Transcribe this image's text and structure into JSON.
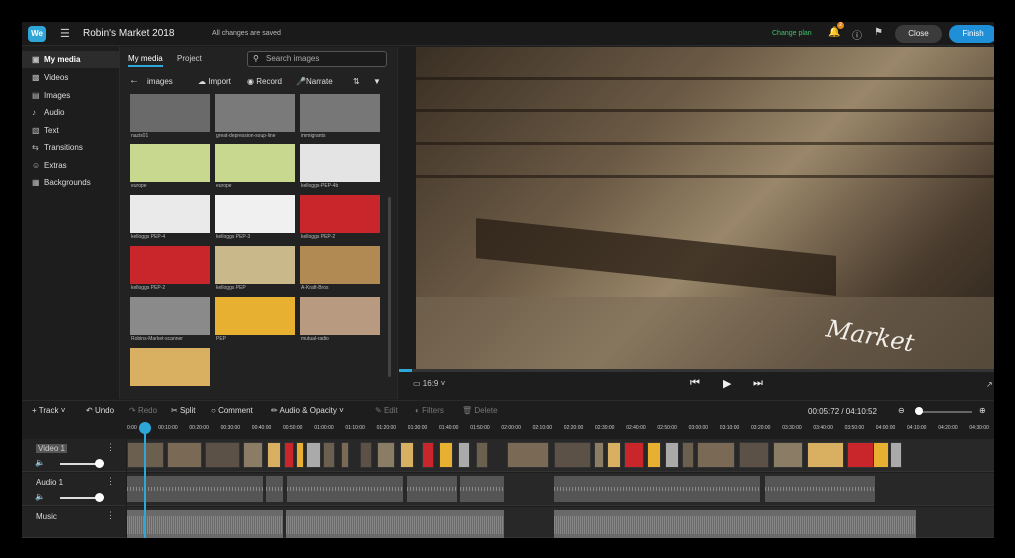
{
  "app": {
    "logo": "We",
    "title": "Robin's Market 2018",
    "save_status": "All changes are saved",
    "change_plan": "Change plan",
    "notification_count": "2",
    "close_label": "Close",
    "finish_label": "Finish",
    "accent": "#2ea7d8"
  },
  "nav": {
    "items": [
      {
        "label": "My media",
        "icon": "folder-icon"
      },
      {
        "label": "Videos",
        "icon": "film-icon"
      },
      {
        "label": "Images",
        "icon": "image-icon"
      },
      {
        "label": "Audio",
        "icon": "music-note-icon"
      },
      {
        "label": "Text",
        "icon": "text-icon"
      },
      {
        "label": "Transitions",
        "icon": "transition-icon"
      },
      {
        "label": "Extras",
        "icon": "smile-icon"
      },
      {
        "label": "Backgrounds",
        "icon": "background-icon"
      }
    ]
  },
  "media": {
    "tabs": [
      "My media",
      "Project"
    ],
    "search_placeholder": "Search images",
    "folder": "images",
    "import_label": "Import",
    "record_label": "Record",
    "narrate_label": "Narrate",
    "items": [
      {
        "label": "nazis01",
        "color": "#6a6a6a"
      },
      {
        "label": "great-depression-soup-line",
        "color": "#7a7a7a"
      },
      {
        "label": "immigrants",
        "color": "#777"
      },
      {
        "label": "europe",
        "color": "#c9d88f"
      },
      {
        "label": "europe",
        "color": "#c9d88f"
      },
      {
        "label": "kelloggs-PEP-4b",
        "color": "#e4e4e4"
      },
      {
        "label": "kelloggs PEP-4",
        "color": "#eaeaea"
      },
      {
        "label": "kelloggs PEP-3",
        "color": "#f0f0f0"
      },
      {
        "label": "kelloggs PEP-2",
        "color": "#c8262a"
      },
      {
        "label": "kelloggs PEP-2",
        "color": "#c8262a"
      },
      {
        "label": "kelloggs PEP",
        "color": "#c9b98a"
      },
      {
        "label": "A-Kraft-Bros",
        "color": "#b08a52"
      },
      {
        "label": "Robins-Market-scanner",
        "color": "#8a8a8a"
      },
      {
        "label": "PEP",
        "color": "#e8b030"
      },
      {
        "label": "mutual-radio",
        "color": "#b89a80"
      },
      {
        "label": "",
        "color": "#d9b061"
      }
    ]
  },
  "preview": {
    "aspect_ratio": "16:9",
    "progress": 0.022
  },
  "toolbar": {
    "track": "Track",
    "undo": "Undo",
    "redo": "Redo",
    "split": "Split",
    "comment": "Comment",
    "audio_opacity": "Audio & Opacity",
    "edit": "Edit",
    "filters": "Filters",
    "delete": "Delete",
    "time": "00:05:72 / 04:10:52"
  },
  "ruler": [
    "0:00",
    "00:10:00",
    "00:20:00",
    "00:30:00",
    "00:40:00",
    "00:50:00",
    "01:00:00",
    "01:10:00",
    "01:20:00",
    "01:30:00",
    "01:40:00",
    "01:50:00",
    "02:00:00",
    "02:10:00",
    "02:20:00",
    "02:30:00",
    "02:40:00",
    "02:50:00",
    "03:00:00",
    "03:10:00",
    "03:20:00",
    "03:30:00",
    "03:40:00",
    "03:50:00",
    "04:00:00",
    "04:10:00",
    "04:20:00",
    "04:30:00"
  ],
  "tracks": {
    "video": "Video 1",
    "audio": "Audio 1",
    "music": "Music"
  }
}
